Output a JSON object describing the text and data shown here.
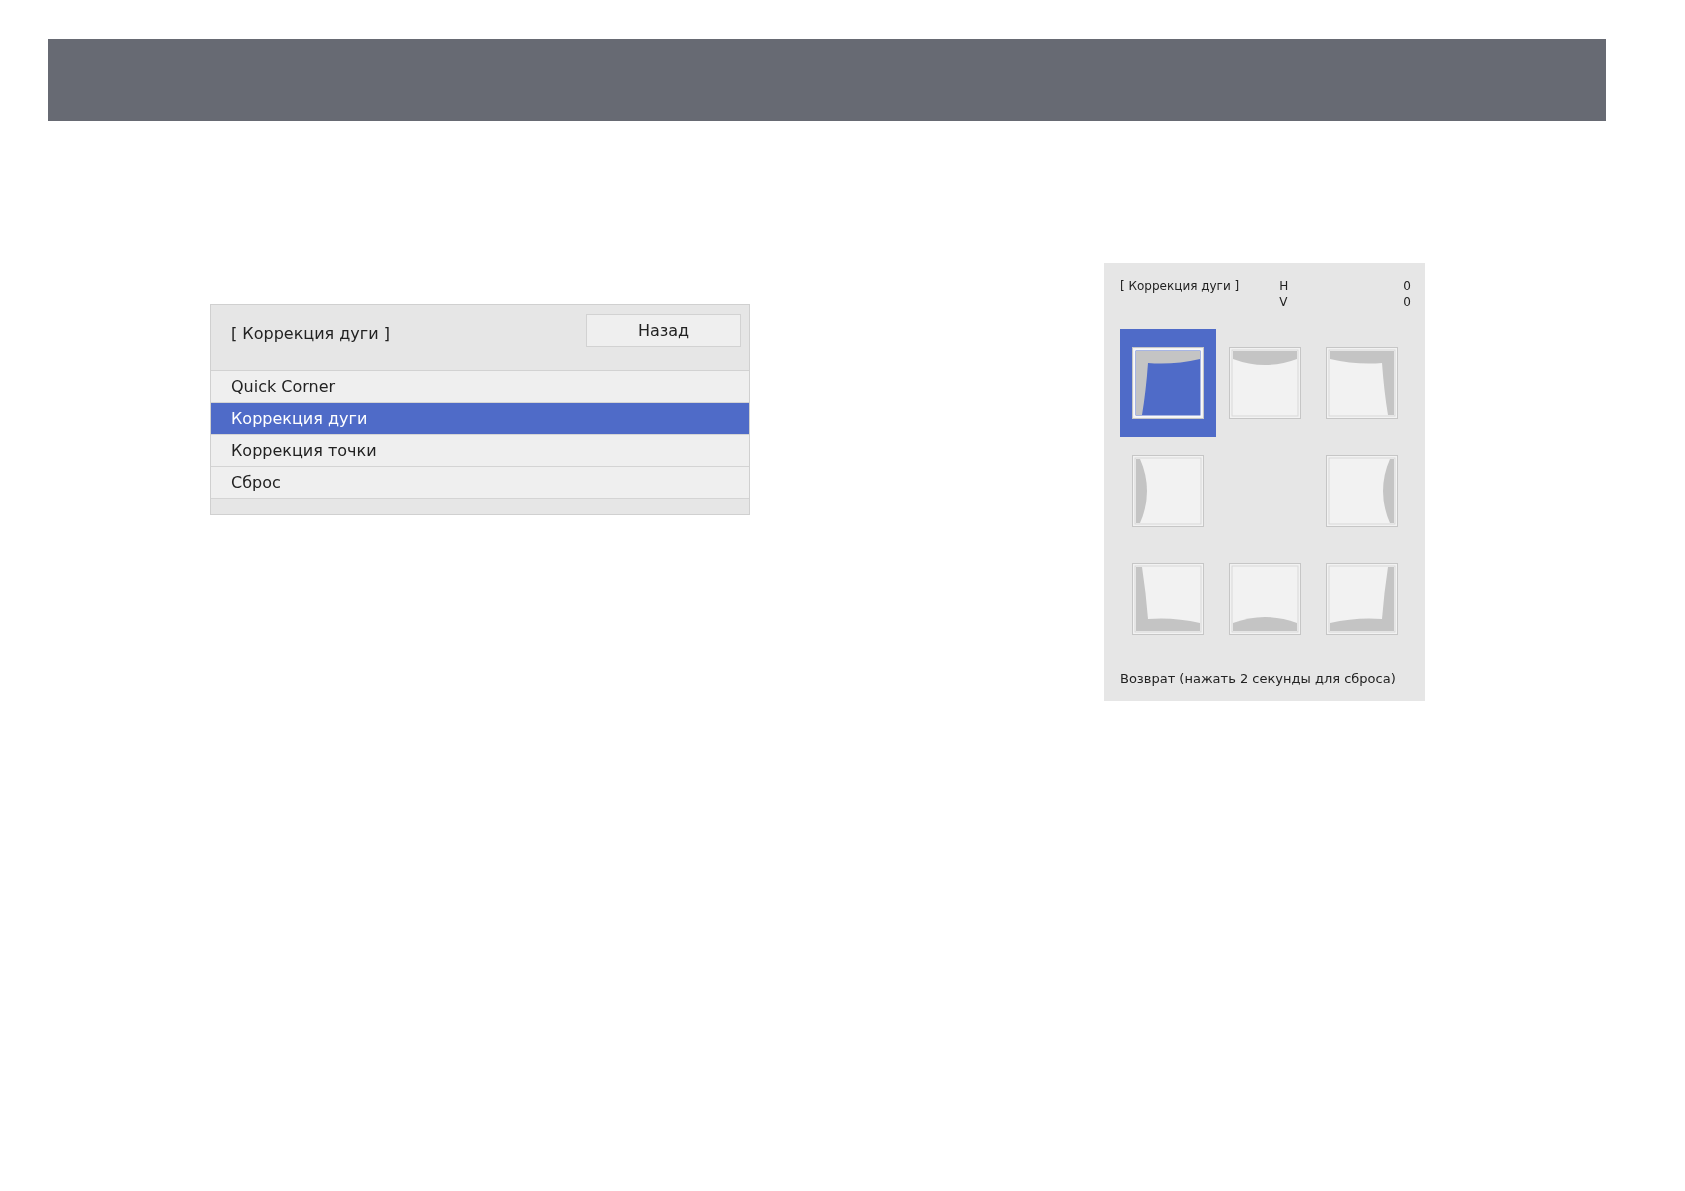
{
  "menu": {
    "title": "[ Коррекция дуги ]",
    "back_button": "Назад",
    "items": [
      {
        "label": "Quick Corner",
        "selected": false
      },
      {
        "label": "Коррекция дуги",
        "selected": true
      },
      {
        "label": "Коррекция точки",
        "selected": false
      },
      {
        "label": "Сброс",
        "selected": false
      }
    ]
  },
  "panel": {
    "title": "[ Коррекция дуги ]",
    "readings": [
      {
        "axis": "H",
        "value": "0"
      },
      {
        "axis": "V",
        "value": "0"
      }
    ],
    "tiles": [
      {
        "kind": "top-left",
        "selected": true
      },
      {
        "kind": "top",
        "selected": false
      },
      {
        "kind": "top-right",
        "selected": false
      },
      {
        "kind": "left",
        "selected": false
      },
      {
        "kind": "right",
        "selected": false
      },
      {
        "kind": "bottom-left",
        "selected": false
      },
      {
        "kind": "bottom",
        "selected": false
      },
      {
        "kind": "bottom-right",
        "selected": false
      }
    ],
    "footer": "Возврат (нажать 2 секунды для сброса)"
  }
}
